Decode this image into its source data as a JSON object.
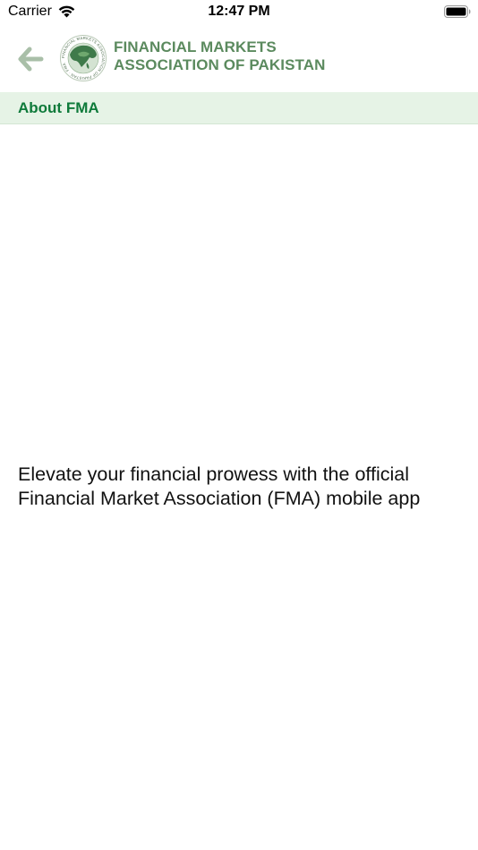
{
  "status_bar": {
    "carrier": "Carrier",
    "time": "12:47 PM"
  },
  "header": {
    "org_name_line1": "FINANCIAL MARKETS",
    "org_name_line2": "ASSOCIATION OF PAKISTAN",
    "logo_seal_text": "FINANCIAL MARKETS ASSOCIATION OF PAKISTAN · FMA"
  },
  "section": {
    "title": "About FMA"
  },
  "content": {
    "tagline": "Elevate your financial prowess with the official Financial Market Association (FMA) mobile app"
  },
  "colors": {
    "brand_green": "#5b8a5e",
    "section_title": "#0e7a3a",
    "section_bg": "#e6f3e6",
    "back_arrow": "#a9bfa8"
  },
  "icons": {
    "back": "arrow-left-icon",
    "wifi": "wifi-icon",
    "battery": "battery-icon",
    "logo": "fma-logo"
  }
}
